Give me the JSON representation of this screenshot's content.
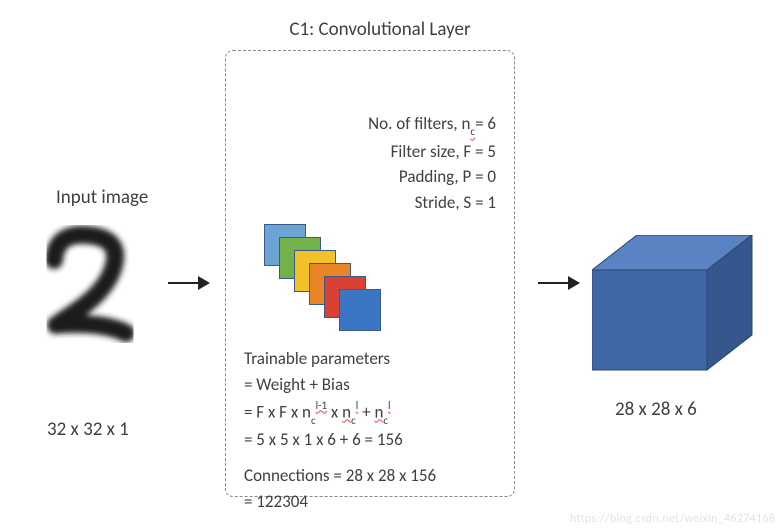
{
  "title": "C1: Convolutional Layer",
  "input": {
    "label": "Input image",
    "caption": "32 x 32 x 1",
    "digit_glyph": "2"
  },
  "output": {
    "caption": "28 x 28 x 6"
  },
  "hyperparams": {
    "filters_label": "No. of filters, ",
    "filters_var": "n",
    "filters_sub": "c",
    "filters_val": "= 6",
    "filtersize_label": "Filter size, F = 5",
    "padding_label": "Padding, P = 0",
    "stride_label": "Stride, S = 1"
  },
  "filter_colors": [
    "#6ea3d6",
    "#73b24a",
    "#f2c029",
    "#e98427",
    "#d94233",
    "#3b76c4"
  ],
  "calc": {
    "line1": "Trainable parameters",
    "line2": "= Weight + Bias",
    "line3_prefix": "= F x F x ",
    "line3_var1": "n",
    "line3_sub1": "c",
    "line3_sup1": "l-1",
    "line3_mid": " x  ",
    "line3_var2": "n",
    "line3_sub2": "c",
    "line3_sup2": "l",
    "line3_plus": " + ",
    "line3_var3": "n",
    "line3_sub3": "c",
    "line3_sup3": "l",
    "line4": "= 5 x 5 x 1 x 6 + 6 = 156",
    "line5": "Connections = 28 x 28 x 156",
    "line6": "= 122304"
  },
  "watermark": "https://blog.csdn.net/weixin_46274168"
}
